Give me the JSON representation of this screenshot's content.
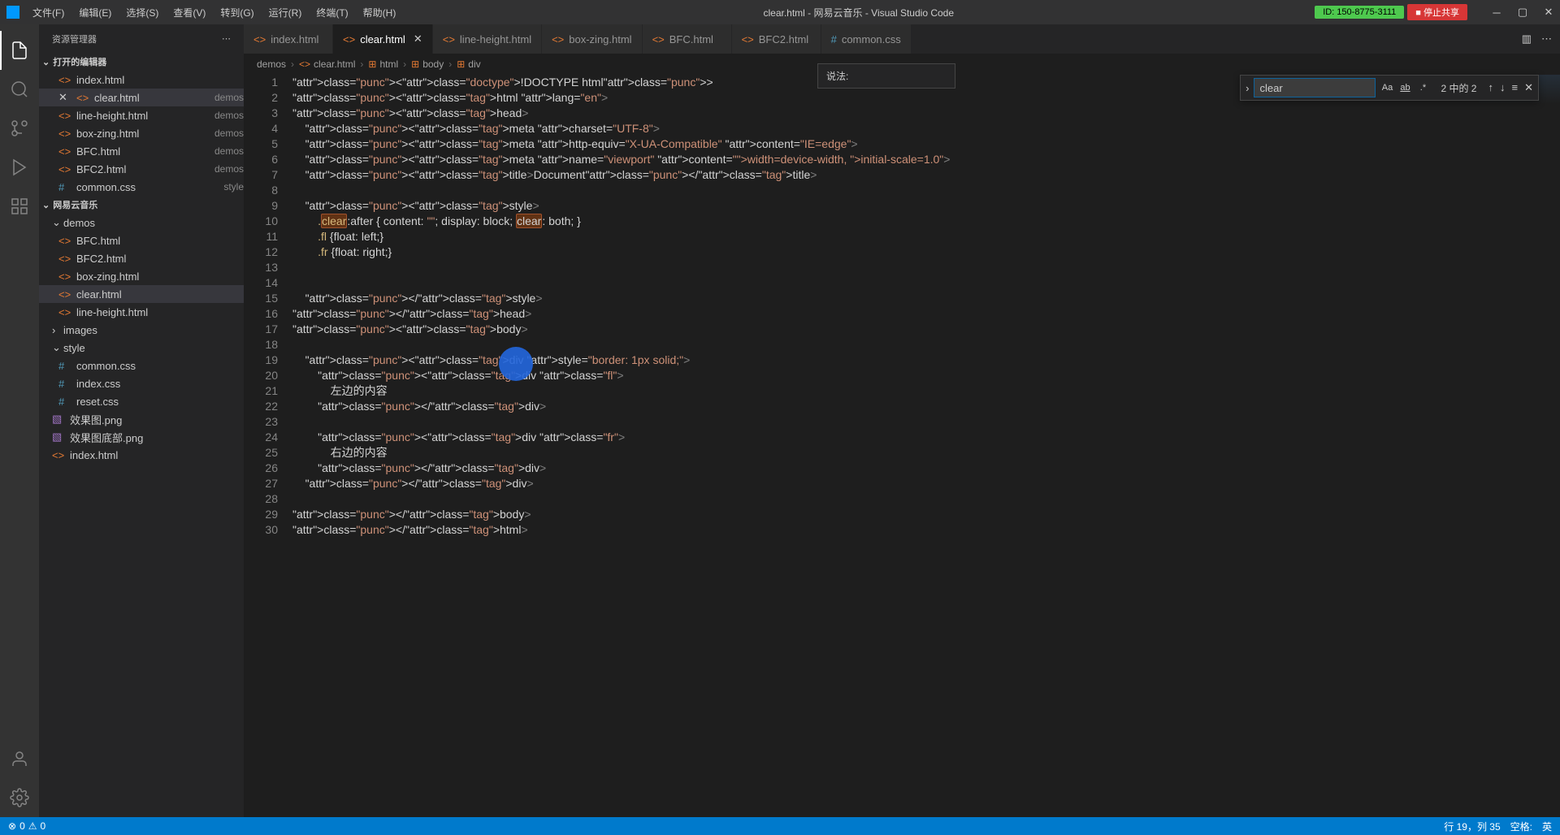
{
  "titlebar": {
    "menu": [
      "文件(F)",
      "编辑(E)",
      "选择(S)",
      "查看(V)",
      "转到(G)",
      "运行(R)",
      "终端(T)",
      "帮助(H)"
    ],
    "title": "clear.html - 网易云音乐 - Visual Studio Code",
    "share_id": "ID: 150-8775-3111",
    "stop_share": "■ 停止共享"
  },
  "sidebar": {
    "title": "资源管理器",
    "open_editors": "打开的编辑器",
    "open_items": [
      {
        "name": "index.html",
        "dim": ""
      },
      {
        "name": "clear.html",
        "dim": "demos",
        "active": true
      },
      {
        "name": "line-height.html",
        "dim": "demos"
      },
      {
        "name": "box-zing.html",
        "dim": "demos"
      },
      {
        "name": "BFC.html",
        "dim": "demos"
      },
      {
        "name": "BFC2.html",
        "dim": "demos"
      },
      {
        "name": "common.css",
        "dim": "style",
        "hash": true
      }
    ],
    "project": "网易云音乐",
    "folders": {
      "demos": [
        "BFC.html",
        "BFC2.html",
        "box-zing.html",
        "clear.html",
        "line-height.html"
      ],
      "images": [],
      "style": [
        "common.css",
        "index.css",
        "reset.css"
      ]
    },
    "root_files": [
      "效果图.png",
      "效果图底部.png",
      "index.html"
    ]
  },
  "tabs": [
    {
      "label": "index.html"
    },
    {
      "label": "clear.html",
      "active": true,
      "close": true
    },
    {
      "label": "line-height.html"
    },
    {
      "label": "box-zing.html"
    },
    {
      "label": "BFC.html"
    },
    {
      "label": "BFC2.html"
    },
    {
      "label": "common.css",
      "hash": true
    }
  ],
  "breadcrumb": [
    "demos",
    "clear.html",
    "html",
    "body",
    "div"
  ],
  "tooltip": "说法:",
  "search": {
    "value": "clear",
    "count": "2 中的 2"
  },
  "code": {
    "lines": [
      "<!DOCTYPE html>",
      "<html lang=\"en\">",
      "<head>",
      "    <meta charset=\"UTF-8\">",
      "    <meta http-equiv=\"X-UA-Compatible\" content=\"IE=edge\">",
      "    <meta name=\"viewport\" content=\"width=device-width, initial-scale=1.0\">",
      "    <title>Document</title>",
      "",
      "    <style>",
      "        .clear:after { content: \"\"; display: block; clear: both; }",
      "        .fl {float: left;}",
      "        .fr {float: right;}",
      "",
      "",
      "    </style>",
      "</head>",
      "<body>",
      "",
      "    <div style=\"border: 1px solid;\">",
      "        <div class=\"fl\">",
      "            左边的内容",
      "        </div>",
      "",
      "        <div class=\"fr\">",
      "            右边的内容",
      "        </div>",
      "    </div>",
      "",
      "</body>",
      "</html>"
    ]
  },
  "statusbar": {
    "errors": "0",
    "warnings": "0",
    "line_col": "行 19，列 35",
    "spaces": "空格:",
    "ime": "英"
  }
}
